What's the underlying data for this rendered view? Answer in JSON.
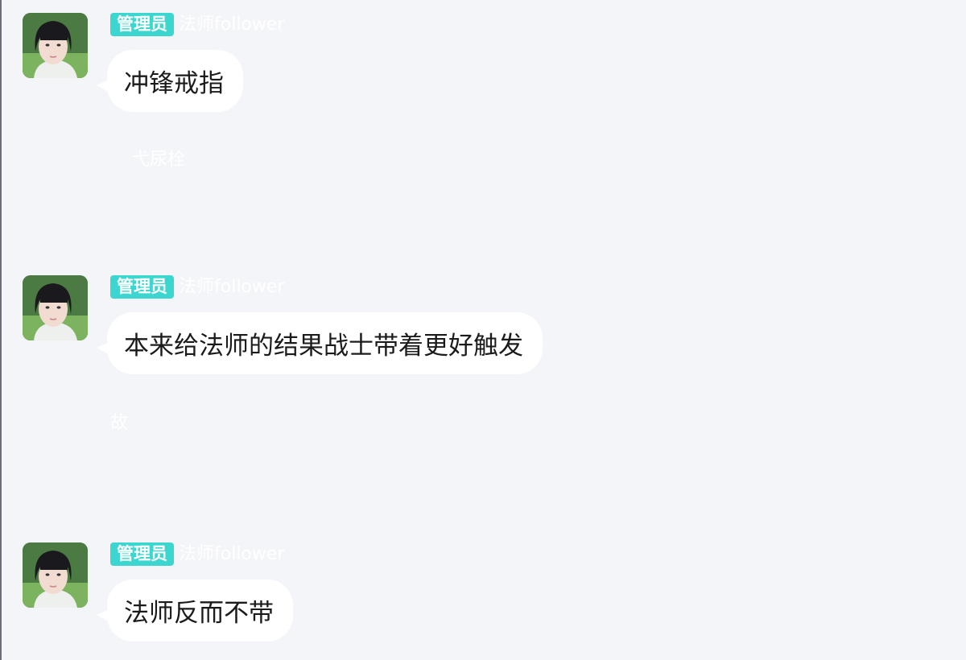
{
  "messages": [
    {
      "badge": "管理员",
      "sender": "法师follower",
      "text": "冲锋戒指",
      "trailing": "弋尿栓"
    },
    {
      "badge": "管理员",
      "sender": "法师follower",
      "text": "本来给法师的结果战士带着更好触发",
      "trailing": "故"
    },
    {
      "badge": "管理员",
      "sender": "法师follower",
      "text": "法师反而不带"
    }
  ],
  "colors": {
    "background": "#f4f5f9",
    "badge": "#3ad6cf",
    "bubble": "#ffffff",
    "text": "#1b1b1b"
  }
}
